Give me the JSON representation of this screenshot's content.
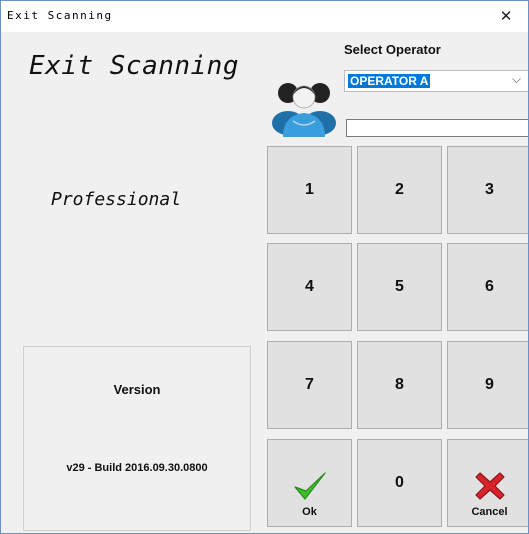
{
  "window": {
    "title": "Exit Scanning",
    "close_glyph": "✕"
  },
  "app": {
    "title": "Exit Scanning",
    "edition": "Professional"
  },
  "version": {
    "label": "Version",
    "build": "v29 - Build 2016.09.30.0800"
  },
  "operator": {
    "label": "Select Operator",
    "selected": "OPERATOR A",
    "code_value": ""
  },
  "keypad": {
    "keys": [
      "1",
      "2",
      "3",
      "4",
      "5",
      "6",
      "7",
      "8",
      "9",
      "0"
    ],
    "ok": {
      "label": "Ok",
      "icon": "checkmark-icon"
    },
    "cancel": {
      "label": "Cancel",
      "icon": "x-icon"
    }
  },
  "colors": {
    "accent": "#0078d7",
    "ok_green": "#3cbf2b",
    "cancel_red": "#d9232b",
    "user_blue": "#3a9ddc"
  }
}
